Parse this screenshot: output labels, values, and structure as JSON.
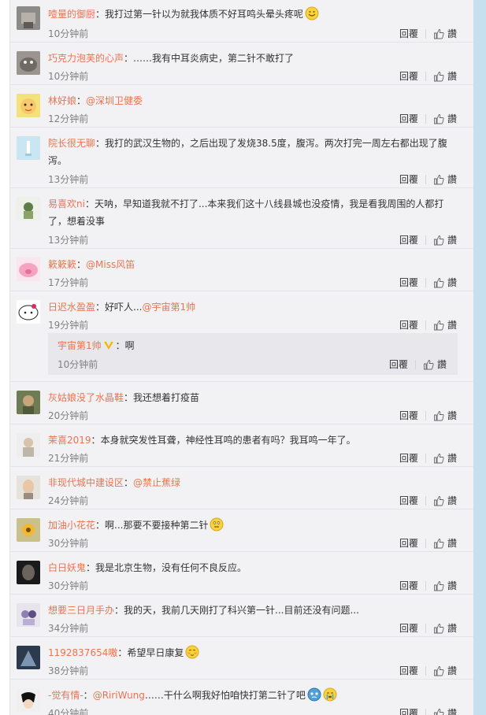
{
  "actions": {
    "reply": "回覆",
    "like": "讚"
  },
  "comments": [
    {
      "name": "噎量的御厨",
      "sep": "：",
      "text": "我打过第一针以为就我体质不好耳鸣头晕头疼呢",
      "time": "10分钟前",
      "emoji": "smile"
    },
    {
      "name": "巧克力泡芙的心声",
      "sep": "：",
      "text": "……我有中耳炎病史，第二针不敢打了",
      "time": "10分钟前"
    },
    {
      "name": "林好娘",
      "sep": "：",
      "mention": "@深圳卫健委",
      "text": "",
      "time": "12分钟前"
    },
    {
      "name": "院长很无聊",
      "sep": "：",
      "text": "我打的武汉生物的，之后出现了发烧38.5度，腹泻。两次打完一周左右都出现了腹泻。",
      "time": "13分钟前"
    },
    {
      "name": "易喜欢ni",
      "sep": "：",
      "text": "天呐，早知道我就不打了...本来我们这十八线县城也没疫情，我是看我周围的人都打了，想着没事",
      "time": "13分钟前"
    },
    {
      "name": "簌簌簌",
      "sep": "：",
      "mention": "@Miss风笛",
      "text": "",
      "time": "17分钟前"
    },
    {
      "name": "日迟水盈盈",
      "sep": "：",
      "text": "好吓人...",
      "mention": "@宇宙第1帅",
      "time": "19分钟前"
    },
    {
      "name": "灰姑娘没了水晶鞋",
      "sep": "：",
      "text": "我还想着打疫苗",
      "time": "20分钟前"
    },
    {
      "name": "茉喜2019",
      "sep": "：",
      "text": "本身就突发性耳聋，神经性耳鸣的患者有吗？我耳鸣一年了。",
      "time": "21分钟前"
    },
    {
      "name": "非现代城中建设区",
      "sep": "：",
      "mention": "@禁止蕉绿",
      "text": "",
      "time": "24分钟前"
    },
    {
      "name": "加油小花花",
      "sep": "：",
      "text": "啊...那要不要接种第二针",
      "time": "30分钟前",
      "emoji": "think"
    },
    {
      "name": "白日妖鬼",
      "sep": "：",
      "text": "我是北京生物，没有任何不良反应。",
      "time": "30分钟前"
    },
    {
      "name": "想要三日月手办",
      "sep": "：",
      "text": "我的天，我前几天刚打了科兴第一针...目前还没有问题...",
      "time": "34分钟前"
    },
    {
      "name": "1192837654嗷",
      "sep": "：",
      "text": "希望早日康复",
      "time": "38分钟前",
      "emoji": "shy"
    },
    {
      "name": "-觉有情-",
      "sep": "：",
      "mention": "@RiriWung",
      "text": "……干什么啊我好怕咱快打第二针了吧",
      "time": "40分钟前",
      "emoji": "cry2"
    }
  ],
  "reply": {
    "name": "宇宙第1帅",
    "sep": "：",
    "text": "啊",
    "time": "10分钟前"
  }
}
